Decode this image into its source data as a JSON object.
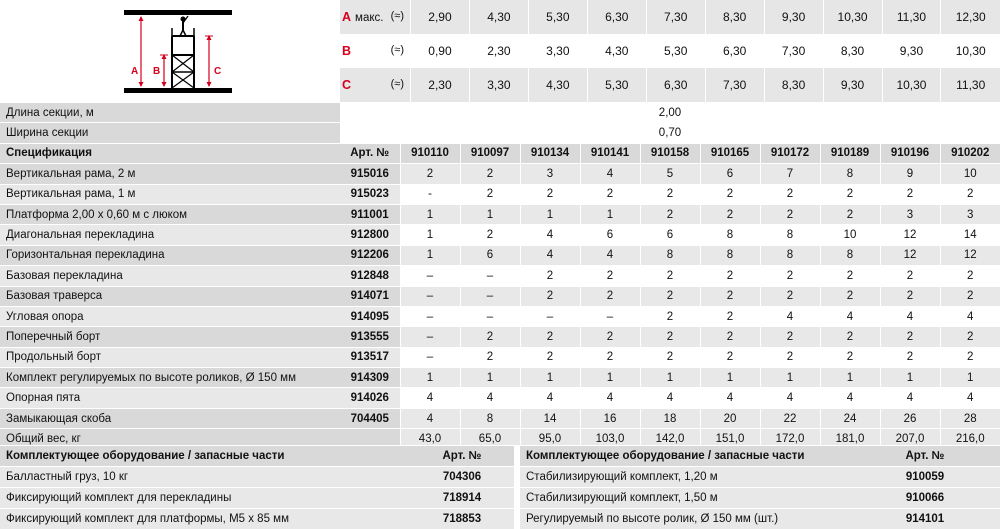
{
  "dimensions": {
    "rows": [
      {
        "letter": "A",
        "label": "макс.",
        "approx": "(≈)",
        "values": [
          "2,90",
          "4,30",
          "5,30",
          "6,30",
          "7,30",
          "8,30",
          "9,30",
          "10,30",
          "11,30",
          "12,30"
        ]
      },
      {
        "letter": "B",
        "label": "",
        "approx": "(≈)",
        "values": [
          "0,90",
          "2,30",
          "3,30",
          "4,30",
          "5,30",
          "6,30",
          "7,30",
          "8,30",
          "9,30",
          "10,30"
        ]
      },
      {
        "letter": "C",
        "label": "",
        "approx": "(≈)",
        "values": [
          "2,30",
          "3,30",
          "4,30",
          "5,30",
          "6,30",
          "7,30",
          "8,30",
          "9,30",
          "10,30",
          "11,30"
        ]
      }
    ],
    "diagram_labels": {
      "a": "A",
      "b": "B",
      "c": "C"
    }
  },
  "section_length": {
    "label": "Длина секции, м",
    "value": "2,00"
  },
  "section_width": {
    "label": "Ширина секции",
    "value": "0,70"
  },
  "spec_header": {
    "label": "Спецификация",
    "art_label": "Арт. №",
    "models": [
      "910110",
      "910097",
      "910134",
      "910141",
      "910158",
      "910165",
      "910172",
      "910189",
      "910196",
      "910202"
    ]
  },
  "spec_rows": [
    {
      "name": "Вертикальная рама, 2 м",
      "art": "915016",
      "values": [
        "2",
        "2",
        "3",
        "4",
        "5",
        "6",
        "7",
        "8",
        "9",
        "10"
      ]
    },
    {
      "name": "Вертикальная рама, 1 м",
      "art": "915023",
      "values": [
        "-",
        "2",
        "2",
        "2",
        "2",
        "2",
        "2",
        "2",
        "2",
        "2"
      ]
    },
    {
      "name": "Платформа 2,00 х 0,60 м с люком",
      "art": "911001",
      "values": [
        "1",
        "1",
        "1",
        "1",
        "2",
        "2",
        "2",
        "2",
        "3",
        "3"
      ]
    },
    {
      "name": "Диагональная перекладина",
      "art": "912800",
      "values": [
        "1",
        "2",
        "4",
        "6",
        "6",
        "8",
        "8",
        "10",
        "12",
        "14"
      ]
    },
    {
      "name": "Горизонтальная перекладина",
      "art": "912206",
      "values": [
        "1",
        "6",
        "4",
        "4",
        "8",
        "8",
        "8",
        "8",
        "12",
        "12"
      ]
    },
    {
      "name": "Базовая перекладина",
      "art": "912848",
      "values": [
        "–",
        "–",
        "2",
        "2",
        "2",
        "2",
        "2",
        "2",
        "2",
        "2"
      ]
    },
    {
      "name": "Базовая траверса",
      "art": "914071",
      "values": [
        "–",
        "–",
        "2",
        "2",
        "2",
        "2",
        "2",
        "2",
        "2",
        "2"
      ]
    },
    {
      "name": "Угловая опора",
      "art": "914095",
      "values": [
        "–",
        "–",
        "–",
        "–",
        "2",
        "2",
        "4",
        "4",
        "4",
        "4"
      ]
    },
    {
      "name": "Поперечный борт",
      "art": "913555",
      "values": [
        "–",
        "2",
        "2",
        "2",
        "2",
        "2",
        "2",
        "2",
        "2",
        "2"
      ]
    },
    {
      "name": "Продольный борт",
      "art": "913517",
      "values": [
        "–",
        "2",
        "2",
        "2",
        "2",
        "2",
        "2",
        "2",
        "2",
        "2"
      ]
    },
    {
      "name": "Комплект регулируемых по высоте роликов, Ø 150 мм",
      "art": "914309",
      "values": [
        "1",
        "1",
        "1",
        "1",
        "1",
        "1",
        "1",
        "1",
        "1",
        "1"
      ]
    },
    {
      "name": "Опорная пята",
      "art": "914026",
      "values": [
        "4",
        "4",
        "4",
        "4",
        "4",
        "4",
        "4",
        "4",
        "4",
        "4"
      ]
    },
    {
      "name": "Замыкающая скоба",
      "art": "704405",
      "values": [
        "4",
        "8",
        "14",
        "16",
        "18",
        "20",
        "22",
        "24",
        "26",
        "28"
      ]
    }
  ],
  "total_weight": {
    "label": "Общий вес, кг",
    "values": [
      "43,0",
      "65,0",
      "95,0",
      "103,0",
      "142,0",
      "151,0",
      "172,0",
      "181,0",
      "207,0",
      "216,0"
    ]
  },
  "accessories": {
    "left_header": "Комплектующее оборудование / запасные части",
    "left_art_header": "Арт. №",
    "right_header": "Комплектующее оборудование / запасные части",
    "right_art_header": "Арт. №",
    "left": [
      {
        "name": "Балластный груз, 10 кг",
        "art": "704306"
      },
      {
        "name": "Фиксирующий комплект для перекладины",
        "art": "718914"
      },
      {
        "name": "Фиксирующий комплект для платформы, M5 х 85 мм",
        "art": "718853"
      }
    ],
    "right": [
      {
        "name": "Стабилизирующий комплект, 1,20 м",
        "art": "910059"
      },
      {
        "name": "Стабилизирующий комплект, 1,50 м",
        "art": "910066"
      },
      {
        "name": "Регулируемый по высоте ролик, Ø 150 мм (шт.)",
        "art": "914101"
      }
    ]
  },
  "colors": {
    "accent": "#d6001c",
    "row_gray": "#e8e8e8",
    "label_gray": "#d9d9d9"
  }
}
